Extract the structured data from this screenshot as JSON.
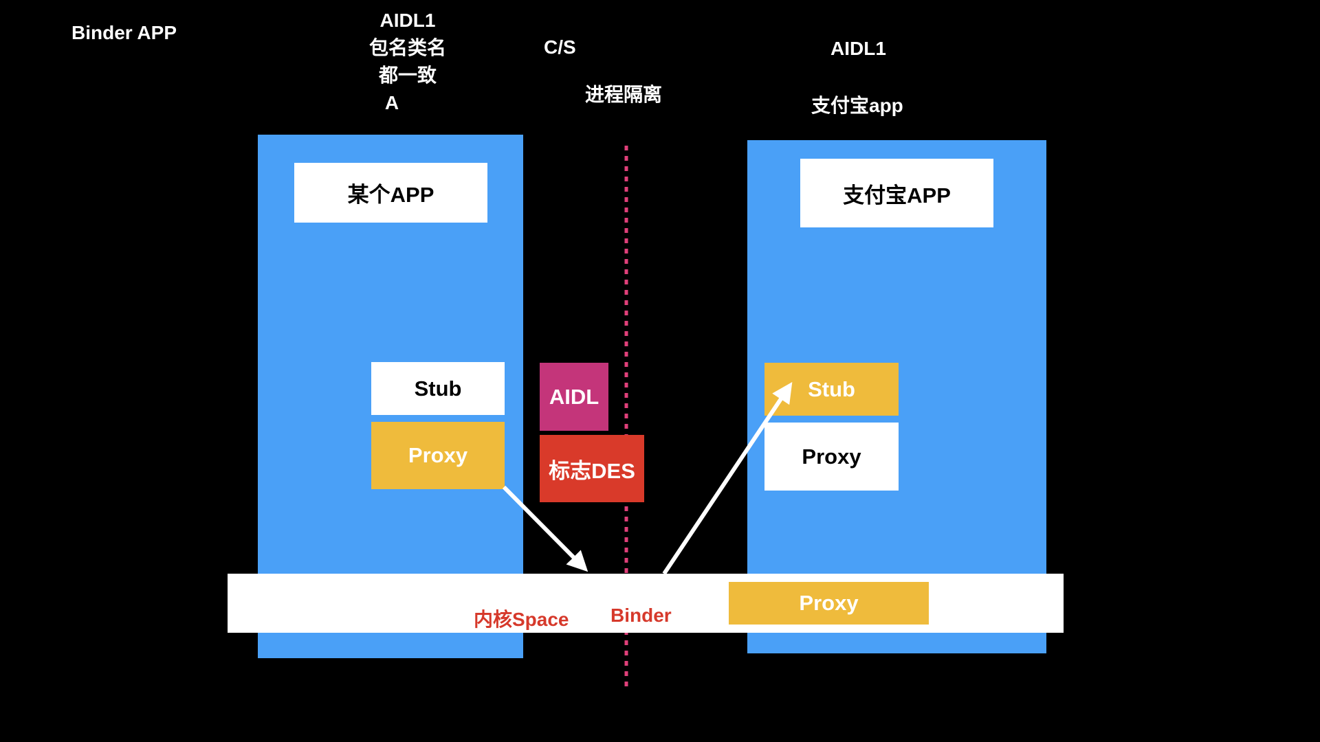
{
  "labels": {
    "binder_app": "Binder APP",
    "aidl_left_lines": [
      "AIDL1",
      "包名类名",
      "都一致",
      "A"
    ],
    "cs": "C/S",
    "isolation": "进程隔离",
    "aidl_right": "AIDL1",
    "alipay_app_lower": "支付宝app"
  },
  "left_process": {
    "app_label": "某个APP",
    "stub_label": "Stub",
    "proxy_label": "Proxy"
  },
  "middle": {
    "aidl_label": "AIDL",
    "des_label": "标志DES"
  },
  "right_process": {
    "app_label": "支付宝APP",
    "stub_label": "Stub",
    "proxy_label": "Proxy"
  },
  "kernel_bar": {
    "kernel_label": "内核Space",
    "binder_label": "Binder",
    "proxy_label": "Proxy"
  },
  "colors": {
    "background": "#000000",
    "panel_blue": "#4aa0f7",
    "yellow": "#efbb3c",
    "magenta": "#c4357a",
    "red": "#d93a2a",
    "divider": "#e0407a"
  }
}
